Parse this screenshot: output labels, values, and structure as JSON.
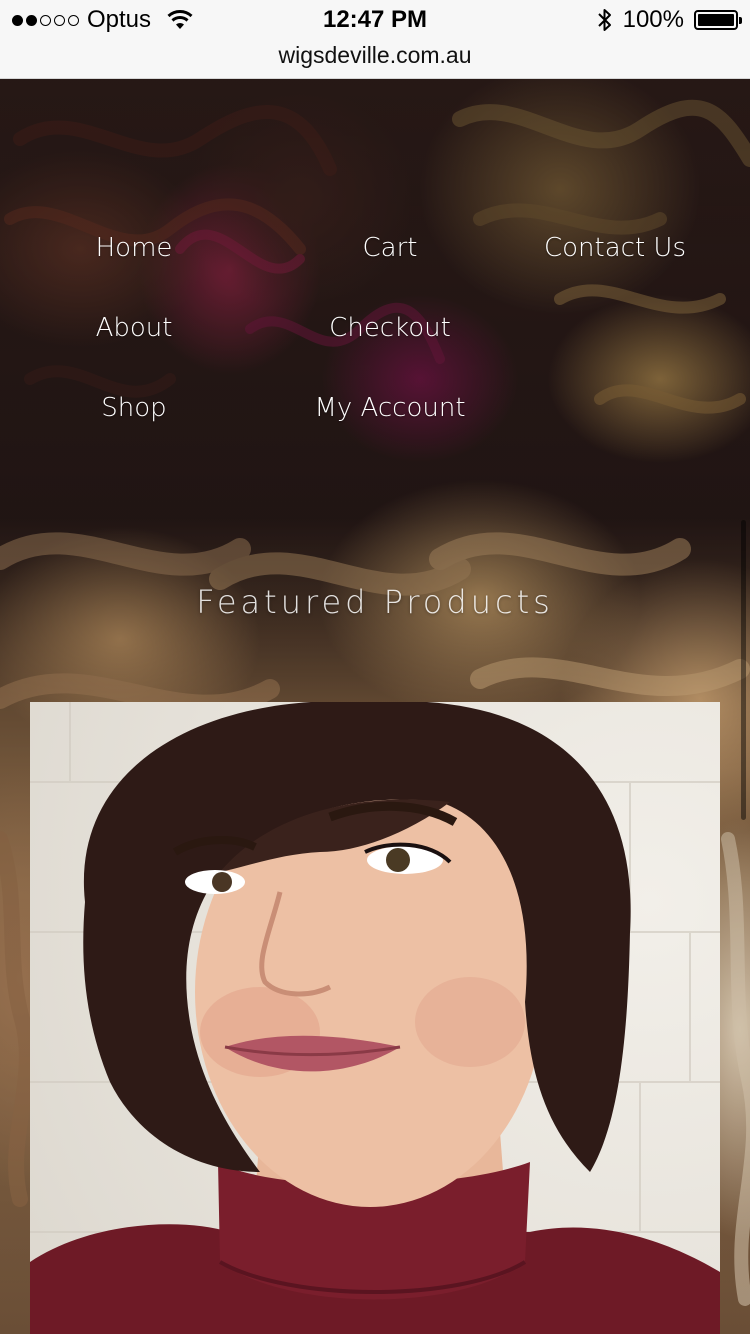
{
  "status_bar": {
    "carrier": "Optus",
    "signal_bars_filled": 2,
    "signal_bars_total": 5,
    "time": "12:47 PM",
    "battery_percent_label": "100%",
    "battery_level": 1.0
  },
  "browser": {
    "url": "wigsdeville.com.au"
  },
  "nav": {
    "items": [
      {
        "label": "Home"
      },
      {
        "label": "Cart"
      },
      {
        "label": "Contact Us"
      },
      {
        "label": "About"
      },
      {
        "label": "Checkout"
      },
      {
        "label": "Shop"
      },
      {
        "label": "My Account"
      }
    ]
  },
  "featured": {
    "heading": "Featured Products"
  },
  "colors": {
    "nav_text": "#ffffff",
    "top_bar_background": "#f7f7f7",
    "dress": "#6e1a26",
    "hair": "#2e1a16"
  }
}
